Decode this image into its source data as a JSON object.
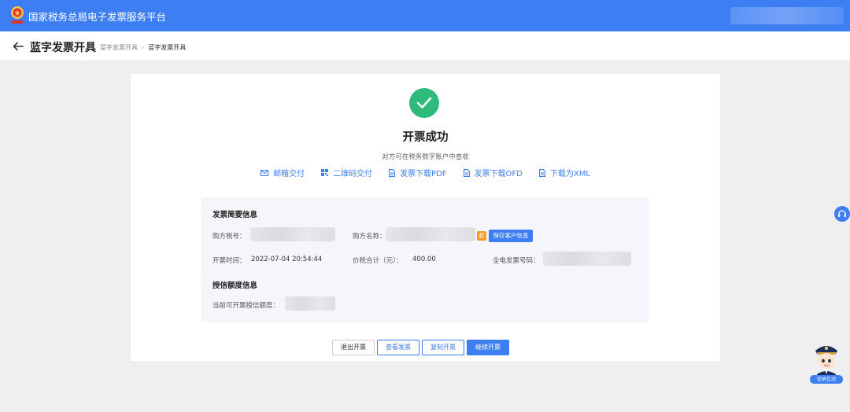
{
  "header": {
    "app_title": "国家税务总局电子发票服务平台",
    "logo_icon": "tax-emblem-icon"
  },
  "subheader": {
    "back_icon": "arrow-left-icon",
    "page_title": "蓝字发票开具",
    "breadcrumb": [
      "蓝字发票开具",
      "蓝字发票开具"
    ]
  },
  "result": {
    "status_icon": "check-circle-icon",
    "title": "开票成功",
    "subtitle": "对方可在税务数字账户中查收",
    "delivery_options": [
      {
        "label": "邮箱交付",
        "icon": "mail-icon"
      },
      {
        "label": "二维码交付",
        "icon": "qrcode-icon"
      },
      {
        "label": "发票下载PDF",
        "icon": "document-icon"
      },
      {
        "label": "发票下载OFD",
        "icon": "document-icon"
      },
      {
        "label": "下载为XML",
        "icon": "document-icon"
      }
    ]
  },
  "summary": {
    "title": "发票简要信息",
    "buyer_tax_no_label": "购方税号：",
    "buyer_name_label": "购方名称：",
    "new_badge": "新",
    "save_customer_button": "保存客户信息",
    "issue_time_label": "开票时间：",
    "issue_time_value": "2022-07-04 20:54:44",
    "total_label": "价税合计（元）：",
    "total_value": "400.00",
    "invoice_no_label": "全电发票号码："
  },
  "credit": {
    "title": "授信额度信息",
    "available_label": "当前可开票授信额度："
  },
  "actions": {
    "exit": "退出开票",
    "view": "查看发票",
    "copy": "复制开票",
    "continue": "继续开票"
  },
  "floating": {
    "support_icon": "headset-icon",
    "assistant_label": "征纳互动",
    "assistant_icon": "assistant-avatar-icon"
  },
  "colors": {
    "brand": "#3d7ff3",
    "success": "#2dba7b",
    "badge": "#f39a2b"
  }
}
